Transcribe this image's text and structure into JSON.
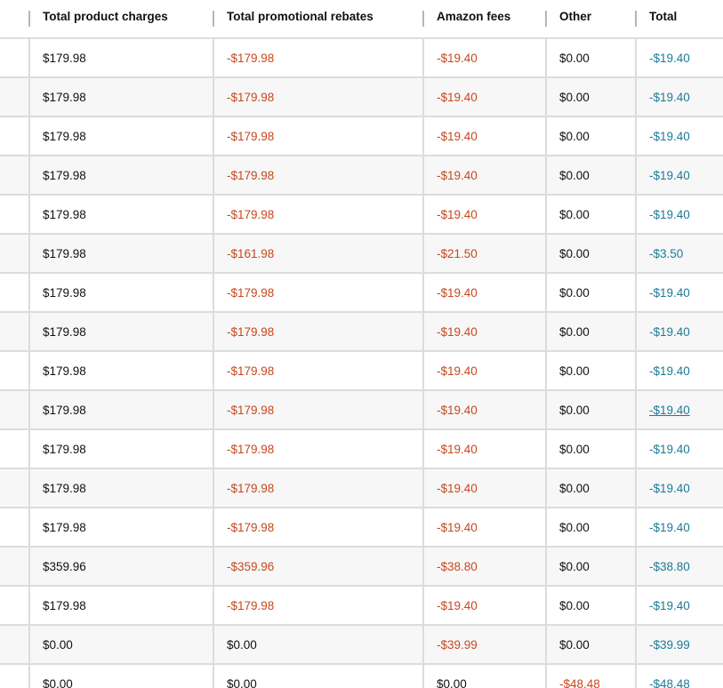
{
  "table": {
    "headers": [
      "Total product charges",
      "Total promotional rebates",
      "Amazon fees",
      "Other",
      "Total"
    ],
    "rows": [
      {
        "product_charges": "$179.98",
        "rebates": "-$179.98",
        "amazon_fees": "-$19.40",
        "other": "$0.00",
        "total": "-$19.40"
      },
      {
        "product_charges": "$179.98",
        "rebates": "-$179.98",
        "amazon_fees": "-$19.40",
        "other": "$0.00",
        "total": "-$19.40"
      },
      {
        "product_charges": "$179.98",
        "rebates": "-$179.98",
        "amazon_fees": "-$19.40",
        "other": "$0.00",
        "total": "-$19.40"
      },
      {
        "product_charges": "$179.98",
        "rebates": "-$179.98",
        "amazon_fees": "-$19.40",
        "other": "$0.00",
        "total": "-$19.40"
      },
      {
        "product_charges": "$179.98",
        "rebates": "-$179.98",
        "amazon_fees": "-$19.40",
        "other": "$0.00",
        "total": "-$19.40"
      },
      {
        "product_charges": "$179.98",
        "rebates": "-$161.98",
        "amazon_fees": "-$21.50",
        "other": "$0.00",
        "total": "-$3.50"
      },
      {
        "product_charges": "$179.98",
        "rebates": "-$179.98",
        "amazon_fees": "-$19.40",
        "other": "$0.00",
        "total": "-$19.40"
      },
      {
        "product_charges": "$179.98",
        "rebates": "-$179.98",
        "amazon_fees": "-$19.40",
        "other": "$0.00",
        "total": "-$19.40"
      },
      {
        "product_charges": "$179.98",
        "rebates": "-$179.98",
        "amazon_fees": "-$19.40",
        "other": "$0.00",
        "total": "-$19.40"
      },
      {
        "product_charges": "$179.98",
        "rebates": "-$179.98",
        "amazon_fees": "-$19.40",
        "other": "$0.00",
        "total": "-$19.40",
        "total_hovered": true
      },
      {
        "product_charges": "$179.98",
        "rebates": "-$179.98",
        "amazon_fees": "-$19.40",
        "other": "$0.00",
        "total": "-$19.40"
      },
      {
        "product_charges": "$179.98",
        "rebates": "-$179.98",
        "amazon_fees": "-$19.40",
        "other": "$0.00",
        "total": "-$19.40"
      },
      {
        "product_charges": "$179.98",
        "rebates": "-$179.98",
        "amazon_fees": "-$19.40",
        "other": "$0.00",
        "total": "-$19.40"
      },
      {
        "product_charges": "$359.96",
        "rebates": "-$359.96",
        "amazon_fees": "-$38.80",
        "other": "$0.00",
        "total": "-$38.80"
      },
      {
        "product_charges": "$179.98",
        "rebates": "-$179.98",
        "amazon_fees": "-$19.40",
        "other": "$0.00",
        "total": "-$19.40"
      },
      {
        "product_charges": "$0.00",
        "rebates": "$0.00",
        "amazon_fees": "-$39.99",
        "other": "$0.00",
        "total": "-$39.99"
      },
      {
        "product_charges": "$0.00",
        "rebates": "$0.00",
        "amazon_fees": "$0.00",
        "other": "-$48.48",
        "total": "-$48.48"
      }
    ]
  },
  "colors": {
    "negative": "#c7471d",
    "total_link": "#1c7b97",
    "text": "#0f1111",
    "row_alt": "#f7f7f7",
    "grid": "#dcdcdc"
  }
}
